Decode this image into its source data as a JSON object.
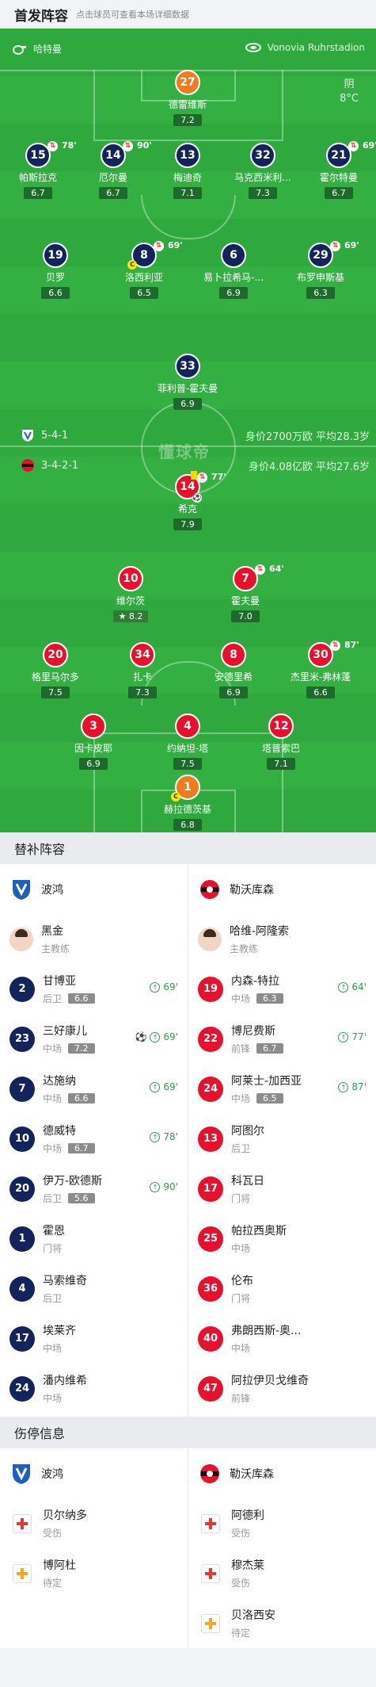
{
  "header": {
    "title": "首发阵容",
    "subtitle": "点击球员可查看本场详细数据"
  },
  "venue": {
    "home_team": "哈特曼",
    "stadium": "Vonovia Ruhrstadion"
  },
  "weather": {
    "condition": "阴",
    "temp": "8°C"
  },
  "formation": {
    "home": {
      "formation": "5-4-1",
      "value": "身价2700万欧",
      "avg_age": "平均28.3岁"
    },
    "away": {
      "formation": "3-4-2-1",
      "value": "身价4.08亿欧",
      "avg_age": "平均27.6岁"
    }
  },
  "watermark": "懂球帝",
  "pitch_players": [
    {
      "num": "27",
      "name": "德雷维斯",
      "rating": "7.2",
      "team": "home",
      "gk": true
    },
    {
      "num": "15",
      "name": "帕斯拉克",
      "rating": "6.7",
      "team": "home",
      "sub": "78'"
    },
    {
      "num": "14",
      "name": "厄尔曼",
      "rating": "6.7",
      "team": "home",
      "sub": "90'"
    },
    {
      "num": "13",
      "name": "梅迪奇",
      "rating": "7.1",
      "team": "home"
    },
    {
      "num": "32",
      "name": "马克西米利...",
      "rating": "7.3",
      "team": "home"
    },
    {
      "num": "21",
      "name": "霍尔特曼",
      "rating": "6.7",
      "team": "home",
      "sub": "69'"
    },
    {
      "num": "19",
      "name": "贝罗",
      "rating": "6.6",
      "team": "home"
    },
    {
      "num": "8",
      "name": "洛西利亚",
      "rating": "6.5",
      "team": "home",
      "sub": "69'",
      "captain": true
    },
    {
      "num": "6",
      "name": "易卜拉希马-...",
      "rating": "6.9",
      "team": "home"
    },
    {
      "num": "29",
      "name": "布罗申斯基",
      "rating": "6.3",
      "team": "home",
      "sub": "69'"
    },
    {
      "num": "33",
      "name": "菲利普-霍夫曼",
      "rating": "6.9",
      "team": "home"
    },
    {
      "num": "14",
      "name": "希克",
      "rating": "7.9",
      "team": "away",
      "sub": "77'",
      "card": true,
      "goal": true
    },
    {
      "num": "10",
      "name": "维尔茨",
      "rating": "8.2",
      "team": "away",
      "star": true
    },
    {
      "num": "7",
      "name": "霍夫曼",
      "rating": "7.0",
      "team": "away",
      "sub": "64'"
    },
    {
      "num": "20",
      "name": "格里马尔多",
      "rating": "7.5",
      "team": "away"
    },
    {
      "num": "34",
      "name": "扎卡",
      "rating": "7.3",
      "team": "away"
    },
    {
      "num": "8",
      "name": "安德里希",
      "rating": "6.9",
      "team": "away"
    },
    {
      "num": "30",
      "name": "杰里米-弗林蓬",
      "rating": "6.6",
      "team": "away",
      "sub": "87'"
    },
    {
      "num": "3",
      "name": "因卡皮耶",
      "rating": "6.9",
      "team": "away"
    },
    {
      "num": "4",
      "name": "约纳坦-塔",
      "rating": "7.5",
      "team": "away"
    },
    {
      "num": "12",
      "name": "塔普索巴",
      "rating": "7.1",
      "team": "away"
    },
    {
      "num": "1",
      "name": "赫拉德茨基",
      "rating": "6.8",
      "team": "away",
      "gk": true,
      "captain": true
    }
  ],
  "subs": {
    "title": "替补阵容",
    "home_team": "波鸿",
    "away_team": "勒沃库森",
    "home_coach": {
      "name": "黑金",
      "role": "主教练"
    },
    "away_coach": {
      "name": "哈维-阿隆索",
      "role": "主教练"
    },
    "home": [
      {
        "num": "2",
        "name": "甘博亚",
        "pos": "后卫",
        "rating": "6.6",
        "in": "69'"
      },
      {
        "num": "23",
        "name": "三好康儿",
        "pos": "中场",
        "rating": "7.2",
        "in": "69'",
        "goal": true
      },
      {
        "num": "7",
        "name": "达施纳",
        "pos": "中场",
        "rating": "6.6",
        "in": "69'"
      },
      {
        "num": "10",
        "name": "德威特",
        "pos": "中场",
        "rating": "6.7",
        "in": "78'"
      },
      {
        "num": "20",
        "name": "伊万-欧德斯",
        "pos": "后卫",
        "rating": "5.6",
        "in": "90'"
      },
      {
        "num": "1",
        "name": "霍恩",
        "pos": "门将"
      },
      {
        "num": "4",
        "name": "马索维奇",
        "pos": "后卫"
      },
      {
        "num": "17",
        "name": "埃莱齐",
        "pos": "中场"
      },
      {
        "num": "24",
        "name": "潘内维希",
        "pos": "中场"
      }
    ],
    "away": [
      {
        "num": "19",
        "name": "内森-特拉",
        "pos": "中场",
        "rating": "6.3",
        "in": "64'"
      },
      {
        "num": "22",
        "name": "博尼费斯",
        "pos": "前锋",
        "rating": "6.7",
        "in": "77'"
      },
      {
        "num": "24",
        "name": "阿莱士-加西亚",
        "pos": "中场",
        "rating": "6.5",
        "in": "87'"
      },
      {
        "num": "13",
        "name": "阿图尔",
        "pos": "后卫"
      },
      {
        "num": "17",
        "name": "科瓦日",
        "pos": "门将"
      },
      {
        "num": "25",
        "name": "帕拉西奥斯",
        "pos": "中场"
      },
      {
        "num": "36",
        "name": "伦布",
        "pos": "门将"
      },
      {
        "num": "40",
        "name": "弗朗西斯-奥...",
        "pos": "中场"
      },
      {
        "num": "47",
        "name": "阿拉伊贝戈维奇",
        "pos": "前锋"
      }
    ]
  },
  "injuries": {
    "title": "伤停信息",
    "home_team": "波鸿",
    "away_team": "勒沃库森",
    "home": [
      {
        "name": "贝尔纳多",
        "status": "受伤",
        "type": "red"
      },
      {
        "name": "博阿杜",
        "status": "待定",
        "type": "yellow"
      }
    ],
    "away": [
      {
        "name": "阿德利",
        "status": "受伤",
        "type": "red"
      },
      {
        "name": "穆杰莱",
        "status": "受伤",
        "type": "red"
      },
      {
        "name": "贝洛西安",
        "status": "待定",
        "type": "yellow"
      }
    ]
  },
  "colors": {
    "pitch": "#2fa93d",
    "home": "#12245a",
    "away": "#e8112d",
    "gk": "#f07a1e"
  }
}
